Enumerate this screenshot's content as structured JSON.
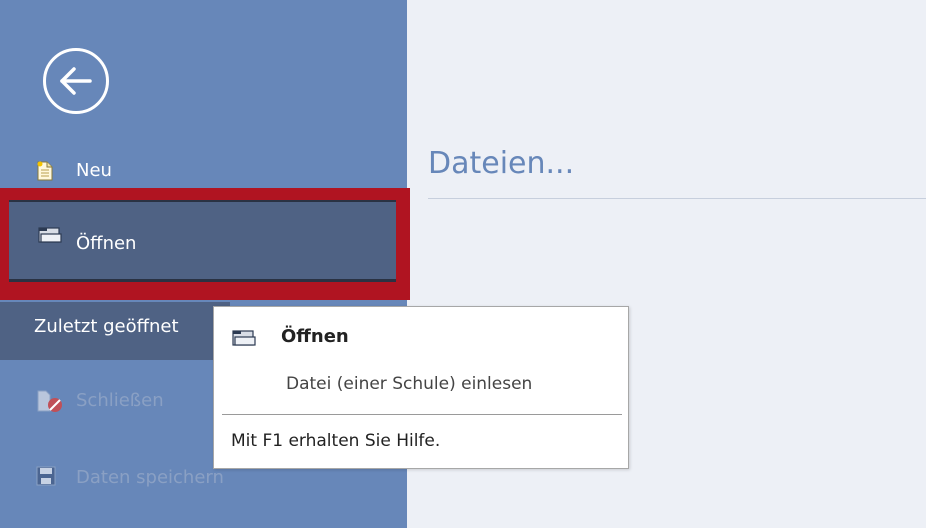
{
  "sidebar": {
    "back_icon": "arrow-left-circle-icon",
    "items": [
      {
        "label": "Neu",
        "icon": "new-document-icon"
      },
      {
        "label": "Öffnen",
        "icon": "folder-open-icon"
      },
      {
        "label": "Zuletzt geöffnet"
      },
      {
        "label": "Schließen",
        "icon": "close-document-icon"
      },
      {
        "label": "Daten speichern",
        "icon": "save-icon"
      }
    ]
  },
  "main": {
    "title": "Dateien..."
  },
  "tooltip": {
    "title": "Öffnen",
    "description": "Datei (einer Schule) einlesen",
    "help": "Mit F1 erhalten Sie Hilfe."
  },
  "colors": {
    "sidebar": "#6787b9",
    "selected": "#4f6284",
    "highlight_border": "#b01421",
    "content_bg": "#edf0f6"
  }
}
